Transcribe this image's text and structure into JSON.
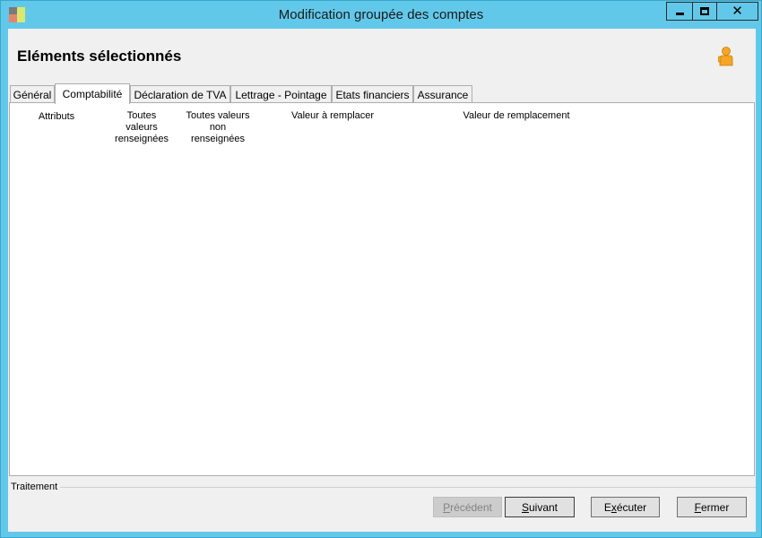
{
  "window": {
    "title": "Modification groupée des comptes",
    "controls": {
      "minimize": "minimize",
      "maximize": "maximize",
      "close": "✕"
    }
  },
  "header": {
    "title": "Eléments sélectionnés"
  },
  "tabs": [
    {
      "label": "Général",
      "active": false
    },
    {
      "label": "Comptabilité",
      "active": true
    },
    {
      "label": "Déclaration de TVA",
      "active": false
    },
    {
      "label": "Lettrage - Pointage",
      "active": false
    },
    {
      "label": "Etats financiers",
      "active": false
    },
    {
      "label": "Assurance",
      "active": false
    }
  ],
  "columns": {
    "attributs": "Attributs",
    "all_filled": [
      "Toutes",
      "valeurs",
      "renseignées"
    ],
    "all_empty": [
      "Toutes valeurs",
      "non",
      "renseignées"
    ],
    "to_replace": "Valeur à remplacer",
    "replacement": "Valeur de remplacement"
  },
  "traitement": {
    "label": "Traitement"
  },
  "buttons": {
    "previous": {
      "mnemonic": "P",
      "rest": "récédent",
      "disabled": true
    },
    "next": {
      "mnemonic": "S",
      "rest": "uivant"
    },
    "execute": {
      "pre": "E",
      "mnemonic": "x",
      "rest": "écuter"
    },
    "close": {
      "mnemonic": "F",
      "rest": "ermer"
    }
  },
  "colors": {
    "title_bar": "#62c8ea",
    "client_bg": "#f0f0f0",
    "user_icon": "#f5a623"
  }
}
